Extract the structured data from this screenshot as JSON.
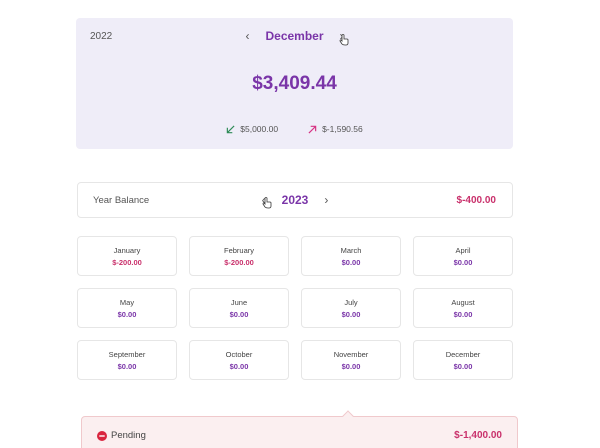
{
  "month_card": {
    "year": "2022",
    "month": "December",
    "total": "$3,409.44",
    "income": "$5,000.00",
    "expense": "$-1,590.56"
  },
  "year_bar": {
    "label": "Year Balance",
    "year": "2023",
    "balance": "$-400.00"
  },
  "months": [
    {
      "name": "January",
      "value": "$-200.00",
      "negative": true
    },
    {
      "name": "February",
      "value": "$-200.00",
      "negative": true
    },
    {
      "name": "March",
      "value": "$0.00",
      "negative": false
    },
    {
      "name": "April",
      "value": "$0.00",
      "negative": false
    },
    {
      "name": "May",
      "value": "$0.00",
      "negative": false
    },
    {
      "name": "June",
      "value": "$0.00",
      "negative": false
    },
    {
      "name": "July",
      "value": "$0.00",
      "negative": false
    },
    {
      "name": "August",
      "value": "$0.00",
      "negative": false
    },
    {
      "name": "September",
      "value": "$0.00",
      "negative": false
    },
    {
      "name": "October",
      "value": "$0.00",
      "negative": false
    },
    {
      "name": "November",
      "value": "$0.00",
      "negative": false
    },
    {
      "name": "December",
      "value": "$0.00",
      "negative": false
    }
  ],
  "pending": {
    "label": "Pending",
    "amount": "$-1,400.00"
  },
  "icons": {
    "prev": "chevron-left-icon",
    "next": "chevron-right-icon",
    "income": "arrow-down-left-icon",
    "expense": "arrow-up-right-icon",
    "pending": "minus-circle-icon",
    "cursor": "hand-pointer-icon"
  },
  "colors": {
    "accent": "#7a35a8",
    "negative": "#c9306b",
    "income": "#2e8b57",
    "card_bg": "#efedf8",
    "pending_bg": "#fbeff0"
  }
}
